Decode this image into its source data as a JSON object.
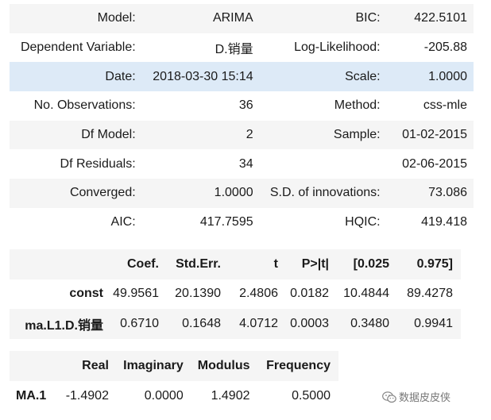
{
  "summary": {
    "rows": [
      [
        "Model:",
        "ARIMA",
        "BIC:",
        "422.5101"
      ],
      [
        "Dependent Variable:",
        "D.销量",
        "Log-Likelihood:",
        "-205.88"
      ],
      [
        "Date:",
        "2018-03-30 15:14",
        "Scale:",
        "1.0000"
      ],
      [
        "No. Observations:",
        "36",
        "Method:",
        "css-mle"
      ],
      [
        "Df Model:",
        "2",
        "Sample:",
        "01-02-2015"
      ],
      [
        "Df Residuals:",
        "34",
        "",
        "02-06-2015"
      ],
      [
        "Converged:",
        "1.0000",
        "S.D. of innovations:",
        "73.086"
      ],
      [
        "AIC:",
        "417.7595",
        "HQIC:",
        "419.418"
      ]
    ]
  },
  "coefficients": {
    "headers": [
      "",
      "Coef.",
      "Std.Err.",
      "t",
      "P>|t|",
      "[0.025",
      "0.975]"
    ],
    "rows": [
      [
        "const",
        "49.9561",
        "20.1390",
        "2.4806",
        "0.0182",
        "10.4844",
        "89.4278"
      ],
      [
        "ma.L1.D.销量",
        "0.6710",
        "0.1648",
        "4.0712",
        "0.0003",
        "0.3480",
        "0.9941"
      ]
    ]
  },
  "roots": {
    "headers": [
      "",
      "Real",
      "Imaginary",
      "Modulus",
      "Frequency"
    ],
    "rows": [
      [
        "MA.1",
        "-1.4902",
        "0.0000",
        "1.4902",
        "0.5000"
      ]
    ]
  },
  "watermark": {
    "text": "数据皮皮侠",
    "icon": "wechat-icon"
  }
}
